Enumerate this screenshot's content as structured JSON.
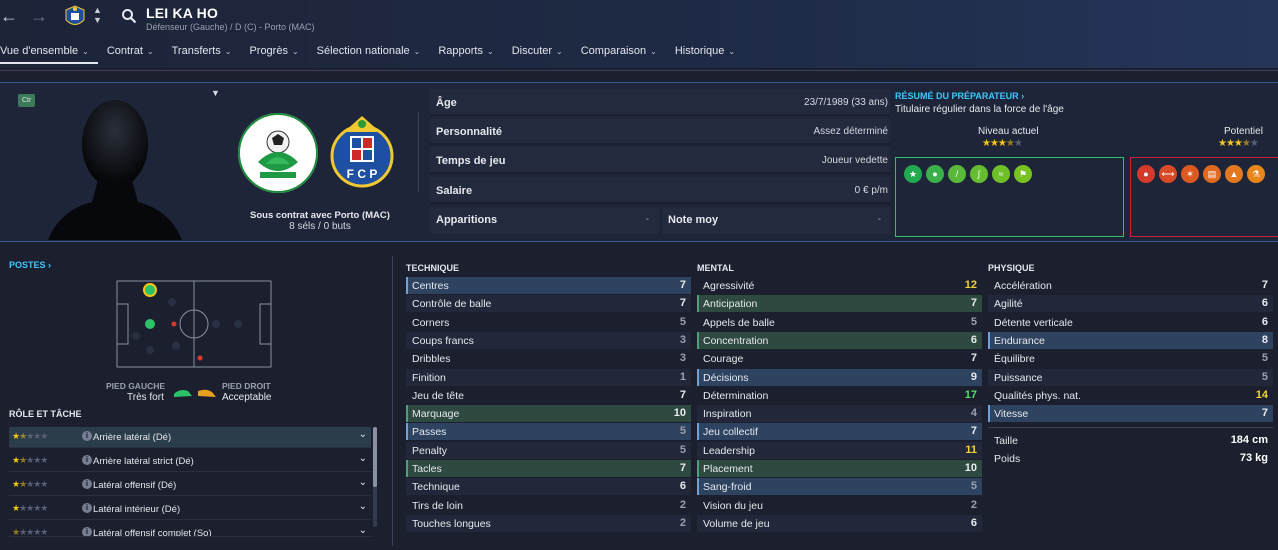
{
  "header": {
    "player_name": "LEI KA HO",
    "subtitle": "Défenseur (Gauche) / D (C) - Porto (MAC)"
  },
  "menu": [
    {
      "label": "Vue d'ensemble"
    },
    {
      "label": "Contrat"
    },
    {
      "label": "Transferts"
    },
    {
      "label": "Progrès"
    },
    {
      "label": "Sélection nationale"
    },
    {
      "label": "Rapports"
    },
    {
      "label": "Discuter"
    },
    {
      "label": "Comparaison"
    },
    {
      "label": "Historique"
    }
  ],
  "profile": {
    "badge": "Ctr",
    "contract_line": "Sous contrat avec Porto (MAC)",
    "stats_line": "8 séls / 0 buts"
  },
  "info": {
    "age_label": "Âge",
    "age_value": "23/7/1989 (33 ans)",
    "personality_label": "Personnalité",
    "personality_value": "Assez déterminé",
    "playtime_label": "Temps de jeu",
    "playtime_value": "Joueur vedette",
    "salary_label": "Salaire",
    "salary_value": "0 € p/m",
    "apps_label": "Apparitions",
    "apps_value": "-",
    "rating_label": "Note moy",
    "rating_value": "-"
  },
  "coach": {
    "link": "RÉSUMÉ DU PRÉPARATEUR",
    "summary": "Titulaire régulier dans la force de l'âge",
    "current_label": "Niveau actuel",
    "potential_label": "Potentiel",
    "current_stars": 3.5,
    "potential_stars": 3.5,
    "colors": {
      "positive": "#2cc26a",
      "negative": "#cc2233",
      "link": "#3cc8ff"
    }
  },
  "positions": {
    "title": "POSTES",
    "left_foot_label": "PIED GAUCHE",
    "left_foot_value": "Très fort",
    "right_foot_label": "PIED DROIT",
    "right_foot_value": "Acceptable"
  },
  "roles": {
    "title": "RÔLE ET TÂCHE",
    "items": [
      {
        "name": "Arrière latéral (Dé)",
        "stars": 1.5
      },
      {
        "name": "Arrière latéral strict (Dé)",
        "stars": 1.5
      },
      {
        "name": "Latéral offensif (Dé)",
        "stars": 1.5
      },
      {
        "name": "Latéral intérieur (Dé)",
        "stars": 1
      },
      {
        "name": "Latéral offensif complet (So)",
        "stars": 0.5
      }
    ]
  },
  "technique": {
    "title": "TECHNIQUE",
    "items": [
      {
        "name": "Centres",
        "value": "7"
      },
      {
        "name": "Contrôle de balle",
        "value": "7"
      },
      {
        "name": "Corners",
        "value": "5"
      },
      {
        "name": "Coups francs",
        "value": "3"
      },
      {
        "name": "Dribbles",
        "value": "3"
      },
      {
        "name": "Finition",
        "value": "1"
      },
      {
        "name": "Jeu de tête",
        "value": "7"
      },
      {
        "name": "Marquage",
        "value": "10"
      },
      {
        "name": "Passes",
        "value": "5"
      },
      {
        "name": "Penalty",
        "value": "5"
      },
      {
        "name": "Tacles",
        "value": "7"
      },
      {
        "name": "Technique",
        "value": "6"
      },
      {
        "name": "Tirs de loin",
        "value": "2"
      },
      {
        "name": "Touches longues",
        "value": "2"
      }
    ]
  },
  "mental": {
    "title": "MENTAL",
    "items": [
      {
        "name": "Agressivité",
        "value": "12"
      },
      {
        "name": "Anticipation",
        "value": "7"
      },
      {
        "name": "Appels de balle",
        "value": "5"
      },
      {
        "name": "Concentration",
        "value": "6"
      },
      {
        "name": "Courage",
        "value": "7"
      },
      {
        "name": "Décisions",
        "value": "9"
      },
      {
        "name": "Détermination",
        "value": "17"
      },
      {
        "name": "Inspiration",
        "value": "4"
      },
      {
        "name": "Jeu collectif",
        "value": "7"
      },
      {
        "name": "Leadership",
        "value": "11"
      },
      {
        "name": "Placement",
        "value": "10"
      },
      {
        "name": "Sang-froid",
        "value": "5"
      },
      {
        "name": "Vision du jeu",
        "value": "2"
      },
      {
        "name": "Volume de jeu",
        "value": "6"
      }
    ]
  },
  "physique": {
    "title": "PHYSIQUE",
    "items": [
      {
        "name": "Accélération",
        "value": "7"
      },
      {
        "name": "Agilité",
        "value": "6"
      },
      {
        "name": "Détente verticale",
        "value": "6"
      },
      {
        "name": "Endurance",
        "value": "8"
      },
      {
        "name": "Équilibre",
        "value": "5"
      },
      {
        "name": "Puissance",
        "value": "5"
      },
      {
        "name": "Qualités phys. nat.",
        "value": "14"
      },
      {
        "name": "Vitesse",
        "value": "7"
      }
    ],
    "height_label": "Taille",
    "height_value": "184 cm",
    "weight_label": "Poids",
    "weight_value": "73 kg"
  }
}
